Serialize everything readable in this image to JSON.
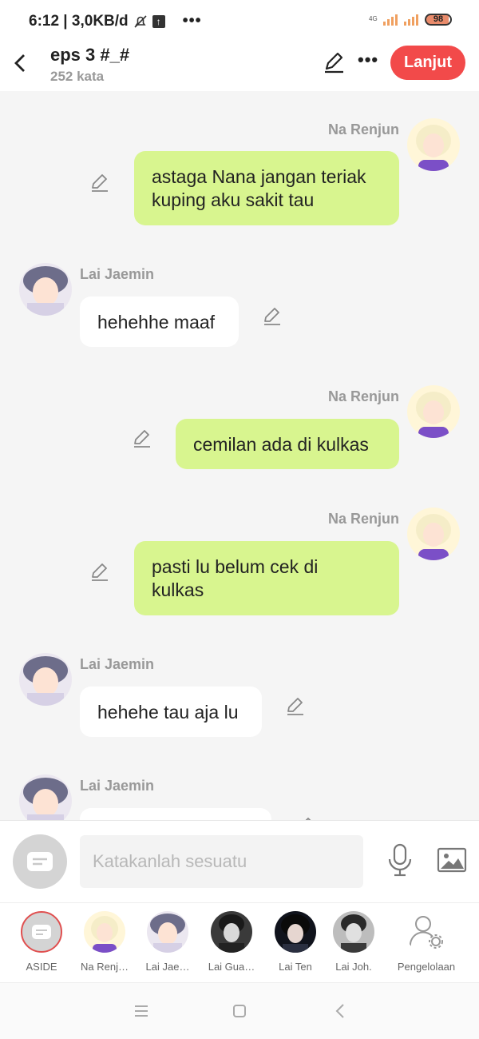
{
  "status_bar": {
    "time_speed": "6:12 | 3,0KB/d",
    "network": "4G",
    "battery": "98"
  },
  "header": {
    "title": "eps 3 #_#",
    "word_count": "252 kata",
    "next_button": "Lanjut"
  },
  "messages": [
    {
      "side": "right",
      "name": "Na Renjun",
      "text_lines": [
        "astaga Nana jangan teriak",
        "kuping aku sakit tau"
      ]
    },
    {
      "side": "left",
      "name": "Lai Jaemin",
      "text_lines": [
        "hehehhe maaf"
      ]
    },
    {
      "side": "right",
      "name": "Na Renjun",
      "text_lines": [
        "cemilan ada di kulkas"
      ]
    },
    {
      "side": "right",
      "name": "Na Renjun",
      "text_lines": [
        "pasti lu belum cek di",
        "kulkas"
      ]
    },
    {
      "side": "left",
      "name": "Lai Jaemin",
      "text_lines": [
        "hehehe tau aja lu"
      ]
    },
    {
      "side": "left",
      "name": "Lai Jaemin",
      "text_lines": []
    }
  ],
  "input": {
    "placeholder": "Katakanlah sesuatu"
  },
  "characters": [
    {
      "label": "ASIDE"
    },
    {
      "label": "Na Renj…"
    },
    {
      "label": "Lai Jae…"
    },
    {
      "label": "Lai Gua…"
    },
    {
      "label": "Lai Ten"
    },
    {
      "label": "Lai Joh."
    },
    {
      "label": "Pengelolaan"
    }
  ],
  "colors": {
    "accent": "#f24a4a",
    "bubble_right": "#d8f58f",
    "bubble_left": "#ffffff",
    "background": "#f5f5f5"
  },
  "icons": [
    "back-arrow-icon",
    "pencil-icon",
    "more-icon",
    "edit-icon",
    "aside-icon",
    "mic-icon",
    "image-icon",
    "manage-icon",
    "menu-icon",
    "home-icon",
    "back-icon"
  ]
}
